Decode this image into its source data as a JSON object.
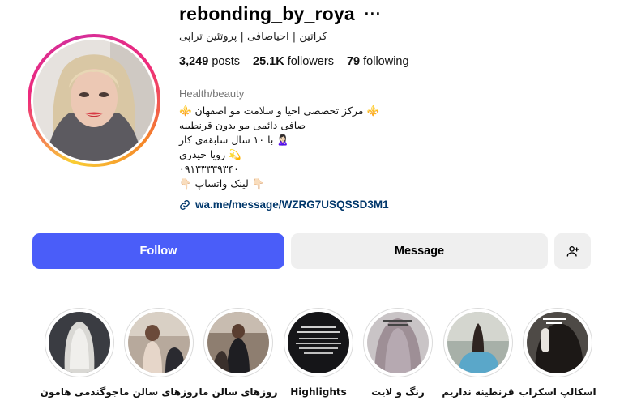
{
  "profile": {
    "username": "rebonding_by_roya",
    "full_name": "کراتین | احیاصافی | پروتئین تراپی",
    "stats": {
      "posts_count": "3,249",
      "posts_label": "posts",
      "followers_count": "25.1K",
      "followers_label": "followers",
      "following_count": "79",
      "following_label": "following"
    },
    "category": "Health/beauty",
    "bio_lines": [
      "⚜️ مرکز تخصصی احیا و سلامت مو اصفهان ⚜️",
      "صافی دائمی مو بدون قرنطینه",
      "🙎🏻‍♀️ با ۱۰ سال سابقه‌ی کار",
      "💫 رویا حیدری",
      "۰۹۱۳۳۳۳۹۳۴۰",
      "👇🏻 لینک واتساپ 👇🏻"
    ],
    "link": "wa.me/message/WZRG7USQSSD3M1"
  },
  "actions": {
    "follow_label": "Follow",
    "message_label": "Message"
  },
  "highlights": [
    {
      "label": "اسکالپ اسکراب"
    },
    {
      "label": "قرنطینه نداریم"
    },
    {
      "label": "رنگ و لایت"
    },
    {
      "label": "Highlights"
    },
    {
      "label": "روزهای سالن ما"
    },
    {
      "label": "روزهای سالن ما"
    },
    {
      "label": "جوگندمی هامون"
    }
  ],
  "icons": {
    "more": "more-horizontal-icon",
    "link": "link-icon",
    "add_user": "add-user-icon"
  },
  "colors": {
    "follow_button": "#4a5df9",
    "secondary_button": "#efefef",
    "link_text": "#00376b",
    "muted_text": "#737373"
  }
}
